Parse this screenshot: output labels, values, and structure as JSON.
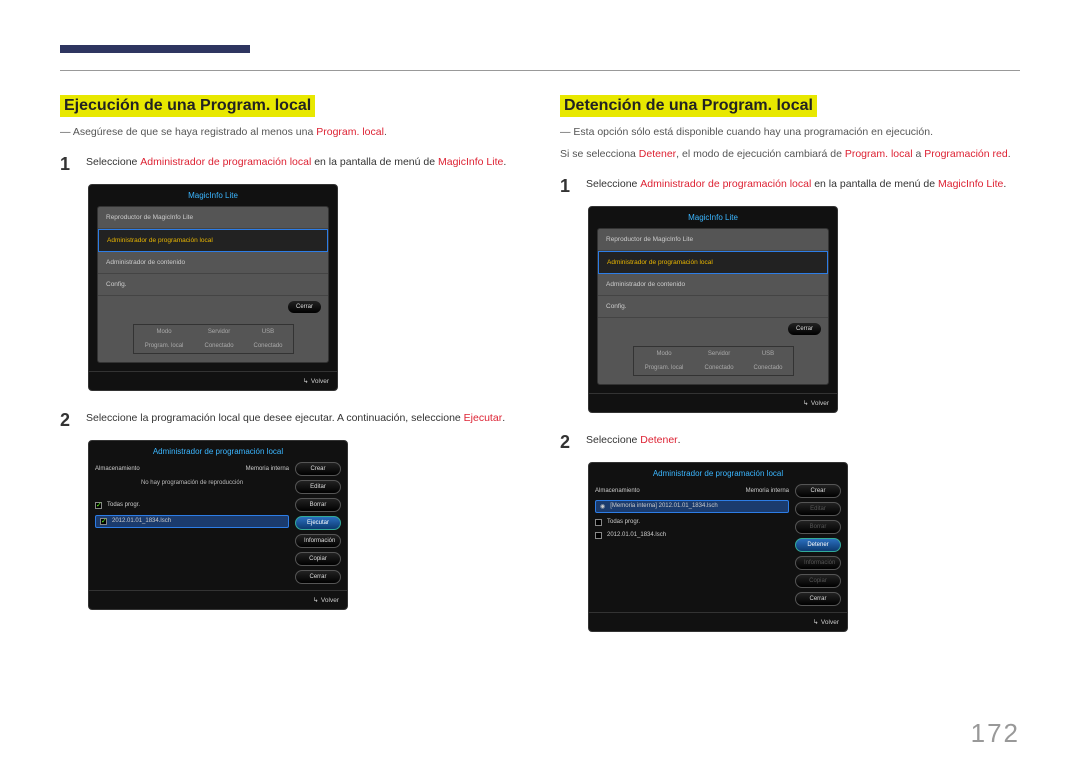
{
  "page_number": "172",
  "left": {
    "title": "Ejecución de una Program. local",
    "note_full": "― Asegúrese de que se haya registrado al menos una Program. local.",
    "step1_pre": "Seleccione ",
    "step1_hl1": "Administrador de programación local",
    "step1_mid": " en la pantalla de menú de ",
    "step1_hl2": "MagicInfo Lite",
    "step1_post": ".",
    "step2_pre": "Seleccione la programación local que desee ejecutar. A continuación, seleccione ",
    "step2_hl": "Ejecutar",
    "step2_post": "."
  },
  "right": {
    "title": "Detención de una Program. local",
    "note1": "― Esta opción sólo está disponible cuando hay una programación en ejecución.",
    "note2_pre": "Si se selecciona ",
    "note2_hl1": "Detener",
    "note2_mid1": ", el modo de ejecución cambiará de ",
    "note2_hl2": "Program. local",
    "note2_mid2": " a ",
    "note2_hl3": "Programación red",
    "note2_post": ".",
    "step1_pre": "Seleccione ",
    "step1_hl1": "Administrador de programación local",
    "step1_mid": " en la pantalla de menú de ",
    "step1_hl2": "MagicInfo Lite",
    "step1_post": ".",
    "step2_pre": "Seleccione ",
    "step2_hl": "Detener",
    "step2_post": "."
  },
  "screenA": {
    "title": "MagicInfo Lite",
    "items": [
      "Reproductor de MagicInfo Lite",
      "Administrador de programación local",
      "Administrador de contenido",
      "Config."
    ],
    "cerrar": "Cerrar",
    "headers": [
      "Modo",
      "Servidor",
      "USB"
    ],
    "values": [
      "Program. local",
      "Conectado",
      "Conectado"
    ],
    "volver": "Volver"
  },
  "screenB_left": {
    "title": "Administrador de programación local",
    "storage_lbl": "Almacenamiento",
    "storage_val": "Memoria interna",
    "nosched": "No hay programación de reproducción",
    "all": "Todas progr.",
    "file": "2012.01.01_1834.lsch",
    "btns": [
      "Crear",
      "Editar",
      "Borrar",
      "Ejecutar",
      "Información",
      "Copiar",
      "Cerrar"
    ],
    "volver": "Volver"
  },
  "screenB_right": {
    "title": "Administrador de programación local",
    "storage_lbl": "Almacenamiento",
    "storage_val": "Memoria interna",
    "running": "[Memoria interna] 2012.01.01_1834.lsch",
    "all": "Todas progr.",
    "file": "2012.01.01_1834.lsch",
    "btns": [
      "Crear",
      "Editar",
      "Borrar",
      "Detener",
      "Información",
      "Copiar",
      "Cerrar"
    ],
    "volver": "Volver"
  }
}
